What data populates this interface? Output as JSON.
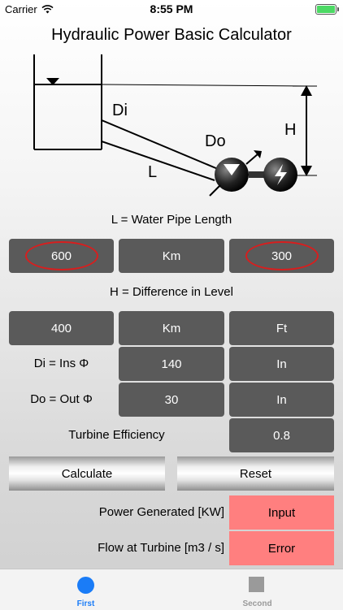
{
  "status": {
    "carrier": "Carrier",
    "time": "8:55 PM"
  },
  "title": "Hydraulic Power Basic Calculator",
  "diagram": {
    "di": "Di",
    "do": "Do",
    "l": "L",
    "h": "H"
  },
  "pipe_length": {
    "caption": "L = Water Pipe Length",
    "value": "600",
    "unit_in": "Km",
    "converted": "300"
  },
  "level": {
    "caption": "H = Difference in Level",
    "value": "400",
    "unit_in": "Km",
    "unit_out": "Ft"
  },
  "di": {
    "label": "Di = Ins Φ",
    "value": "140",
    "unit": "In"
  },
  "do": {
    "label": "Do = Out Φ",
    "value": "30",
    "unit": "In"
  },
  "efficiency": {
    "label": "Turbine Efficiency",
    "value": "0.8"
  },
  "buttons": {
    "calculate": "Calculate",
    "reset": "Reset"
  },
  "results": {
    "power_label": "Power Generated [KW]",
    "power_value": "Input",
    "flow_label": "Flow at Turbine [m3 / s]",
    "flow_value": "Error"
  },
  "tabs": [
    {
      "label": "First",
      "color": "#1a7cf7"
    },
    {
      "label": "Second",
      "color": "#9a9a9a"
    }
  ]
}
